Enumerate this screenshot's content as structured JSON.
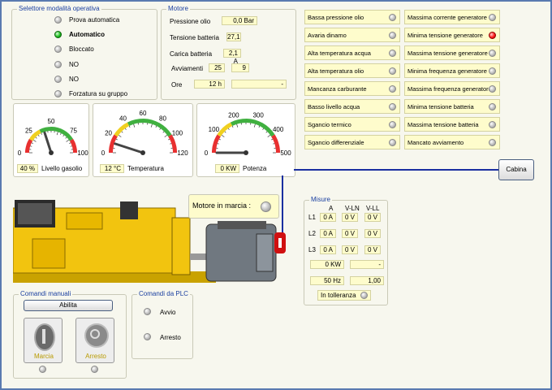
{
  "mode_selector": {
    "title": "Selettore modalità operativa",
    "options": [
      {
        "label": "Prova automatica",
        "state": "off"
      },
      {
        "label": "Automatico",
        "state": "on"
      },
      {
        "label": "Bloccato",
        "state": "off"
      },
      {
        "label": "NO",
        "state": "off"
      },
      {
        "label": "NO",
        "state": "off"
      },
      {
        "label": "Forzatura su gruppo",
        "state": "off"
      }
    ]
  },
  "motore": {
    "title": "Motore",
    "pressione_label": "Pressione olio",
    "pressione_value": "0,0 Bar",
    "tensione_label": "Tensione batteria",
    "tensione_value": "27,1",
    "carica_label": "Carica batteria",
    "carica_value": "2,1 A",
    "avviamenti_label": "Avviamenti",
    "avviamenti_value1": "25",
    "avviamenti_value2": "9",
    "ore_label": "Ore",
    "ore_value": "12 h",
    "ore_extra": "-"
  },
  "alarms_left": [
    "Bassa pressione olio",
    "Avaria dinamo",
    "Alta temperatura acqua",
    "Alta temperatura olio",
    "Mancanza carburante",
    "Basso livello acqua",
    "Sgancio termico",
    "Sgancio differenziale"
  ],
  "alarms_right": [
    {
      "label": "Massima corrente generatore",
      "state": "off"
    },
    {
      "label": "Minima tensione generatore",
      "state": "red"
    },
    {
      "label": "Massima tensione generatore",
      "state": "off"
    },
    {
      "label": "Minima frequenza generatore",
      "state": "off"
    },
    {
      "label": "Massima frequenza generatore",
      "state": "off"
    },
    {
      "label": "Minima tensione batteria",
      "state": "off"
    },
    {
      "label": "Massima tensione batteria",
      "state": "off"
    },
    {
      "label": "Mancato avviamento",
      "state": "off"
    }
  ],
  "gauges": {
    "gasolio": {
      "ticks": [
        "0",
        "25",
        "50",
        "75",
        "100"
      ],
      "value_text": "40 %",
      "label": "Livello gasolio",
      "level": 40,
      "max": 100
    },
    "temperatura": {
      "ticks": [
        "0",
        "20",
        "40",
        "60",
        "80",
        "100",
        "120"
      ],
      "value_text": "12 °C",
      "label": "Temperatura",
      "level": 12,
      "max": 120
    },
    "potenza": {
      "ticks": [
        "0",
        "100",
        "200",
        "300",
        "400",
        "500"
      ],
      "value_text": "0 KW",
      "label": "Potenza",
      "level": 0,
      "max": 500
    }
  },
  "cabina_label": "Cabina",
  "motore_marcia_label": "Motore in marcia :",
  "misure": {
    "title": "Misure",
    "headers": [
      "A",
      "V-LN",
      "V-LL"
    ],
    "rows": [
      {
        "label": "L1",
        "a": "0 A",
        "vln": "0 V",
        "vll": "0 V"
      },
      {
        "label": "L2",
        "a": "0 A",
        "vln": "0 V",
        "vll": "0 V"
      },
      {
        "label": "L3",
        "a": "0 A",
        "vln": "0 V",
        "vll": "0 V"
      }
    ],
    "kw": "0 KW",
    "kw_extra": "-",
    "hz": "50 Hz",
    "cos": "1,00",
    "tolleranza": "In tolleranza"
  },
  "comandi_manuali": {
    "title": "Comandi manuali",
    "abilita": "Abilita",
    "marcia": "Marcia",
    "arresto": "Arresto"
  },
  "comandi_plc": {
    "title": "Comandi da PLC",
    "avvio": "Avvio",
    "arresto": "Arresto"
  },
  "colors": {
    "accent": "#1a3fa0",
    "value_bg": "#fefccc",
    "generator": "#f2c40f"
  }
}
